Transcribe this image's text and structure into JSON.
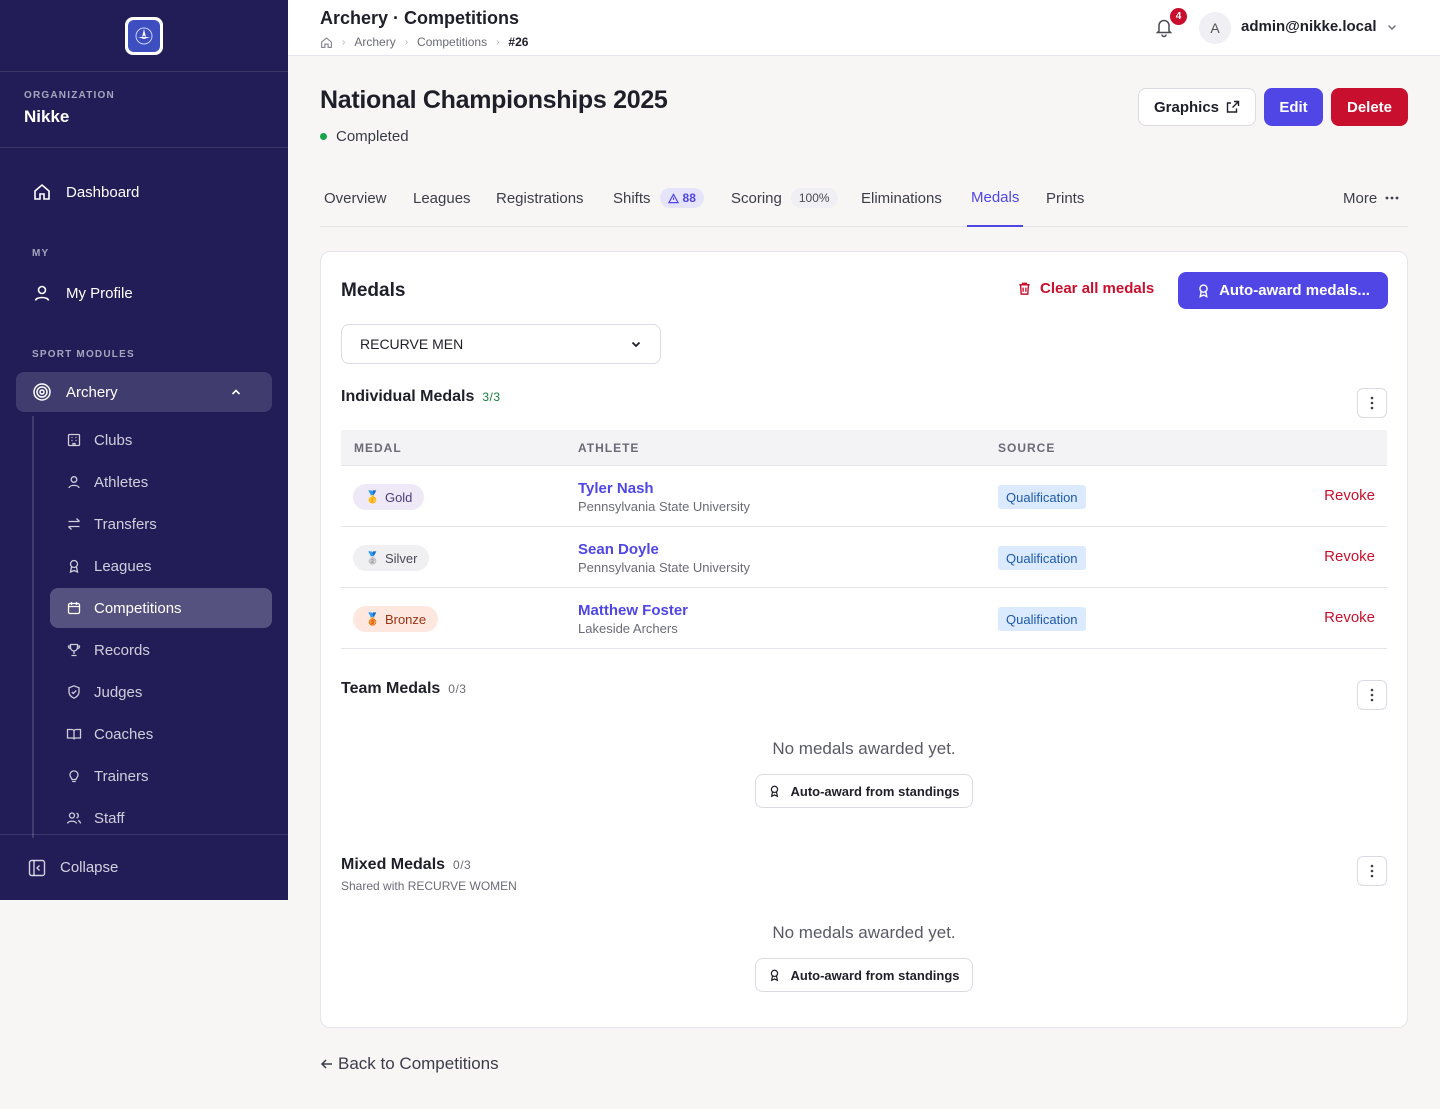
{
  "sidebar": {
    "org_label": "ORGANIZATION",
    "org_name": "Nikke",
    "dashboard": "Dashboard",
    "my_label": "MY",
    "profile": "My Profile",
    "modules_label": "SPORT MODULES",
    "archery": "Archery",
    "sub": {
      "clubs": "Clubs",
      "athletes": "Athletes",
      "transfers": "Transfers",
      "leagues": "Leagues",
      "competitions": "Competitions",
      "records": "Records",
      "judges": "Judges",
      "coaches": "Coaches",
      "trainers": "Trainers",
      "staff": "Staff"
    },
    "collapse": "Collapse"
  },
  "topbar": {
    "title": "Archery · Competitions",
    "breadcrumb": [
      "Archery",
      "Competitions",
      "#26"
    ],
    "notifications": "4",
    "avatar_letter": "A",
    "user": "admin@nikke.local"
  },
  "page": {
    "title": "National Championships 2025",
    "status": "Completed",
    "status_color": "#16a34a",
    "graphics": "Graphics",
    "edit": "Edit",
    "delete": "Delete",
    "back": "Back to Competitions"
  },
  "tabs": {
    "overview": "Overview",
    "leagues": "Leagues",
    "registrations": "Registrations",
    "shifts": "Shifts",
    "shifts_badge": "88",
    "scoring": "Scoring",
    "scoring_badge": "100%",
    "eliminations": "Eliminations",
    "medals": "Medals",
    "prints": "Prints",
    "more": "More"
  },
  "medals": {
    "title": "Medals",
    "clear_all": "Clear all medals",
    "auto_award": "Auto-award medals...",
    "category": "RECURVE MEN",
    "individual": {
      "title": "Individual Medals",
      "count": "3/3",
      "columns": [
        "MEDAL",
        "ATHLETE",
        "SOURCE"
      ],
      "rows": [
        {
          "medal": "Gold",
          "icon": "gold-medal-icon",
          "athlete": "Tyler Nash",
          "club": "Pennsylvania State University",
          "source": "Qualification",
          "action": "Revoke"
        },
        {
          "medal": "Silver",
          "icon": "silver-medal-icon",
          "athlete": "Sean Doyle",
          "club": "Pennsylvania State University",
          "source": "Qualification",
          "action": "Revoke"
        },
        {
          "medal": "Bronze",
          "icon": "bronze-medal-icon",
          "athlete": "Matthew Foster",
          "club": "Lakeside Archers",
          "source": "Qualification",
          "action": "Revoke"
        }
      ]
    },
    "team": {
      "title": "Team Medals",
      "count": "0/3",
      "empty": "No medals awarded yet.",
      "button": "Auto-award from standings"
    },
    "mixed": {
      "title": "Mixed Medals",
      "count": "0/3",
      "subtitle": "Shared with RECURVE WOMEN",
      "empty": "No medals awarded yet.",
      "button": "Auto-award from standings"
    }
  },
  "colors": {
    "sidebar": "#221c57",
    "primary": "#4f46e5",
    "danger": "#c8102e"
  }
}
